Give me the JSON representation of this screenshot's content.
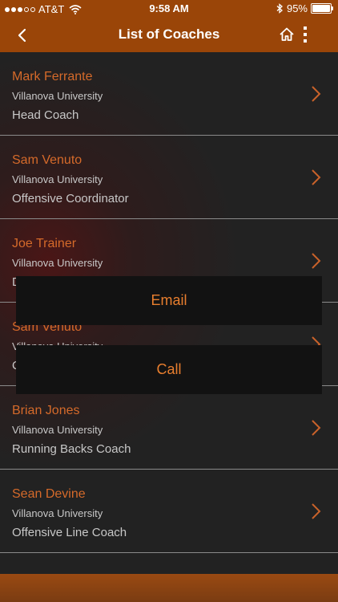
{
  "status_bar": {
    "carrier": "AT&T",
    "time": "9:58 AM",
    "battery": "95%"
  },
  "header": {
    "title": "List of Coaches"
  },
  "coaches": [
    {
      "name": "Mark Ferrante",
      "school": "Villanova University",
      "role": "Head Coach"
    },
    {
      "name": "Sam Venuto",
      "school": "Villanova University",
      "role": "Offensive Coordinator"
    },
    {
      "name": "Joe Trainer",
      "school": "Villanova University",
      "role": "Defensive Coordinator"
    },
    {
      "name": "Sam Venuto",
      "school": "Villanova University",
      "role": "Quarterbacks Coach"
    },
    {
      "name": "Brian Jones",
      "school": "Villanova University",
      "role": "Running Backs Coach"
    },
    {
      "name": "Sean Devine",
      "school": "Villanova University",
      "role": "Offensive Line Coach"
    }
  ],
  "popup": {
    "email_label": "Email",
    "call_label": "Call"
  },
  "colors": {
    "brand": "#9a4508",
    "accent": "#d56a2a"
  }
}
